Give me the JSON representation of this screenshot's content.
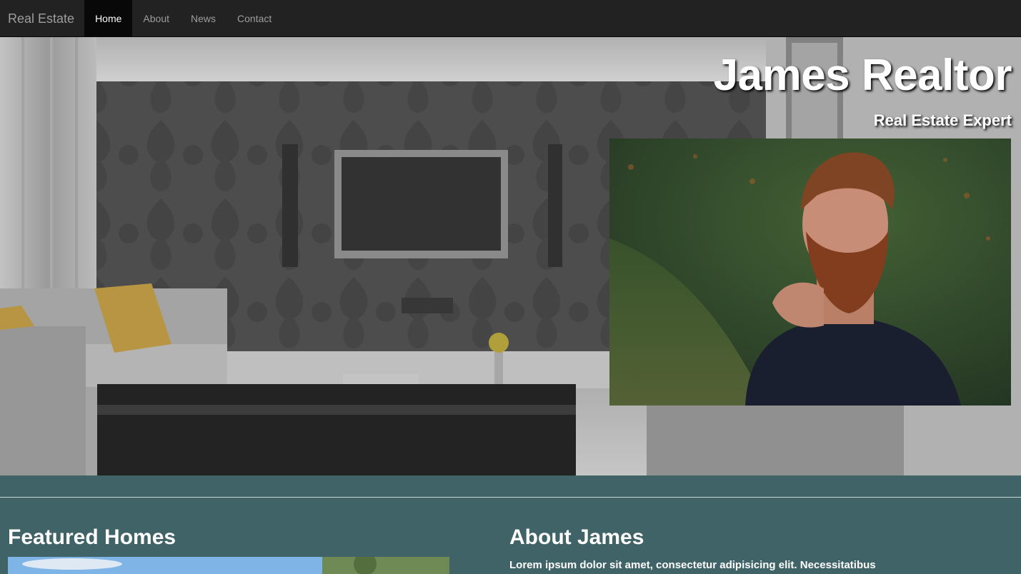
{
  "navbar": {
    "brand": "Real Estate",
    "items": [
      {
        "label": "Home",
        "active": true
      },
      {
        "label": "About",
        "active": false
      },
      {
        "label": "News",
        "active": false
      },
      {
        "label": "Contact",
        "active": false
      }
    ]
  },
  "hero": {
    "title": "James Realtor",
    "subtitle": "Real Estate Expert"
  },
  "featured": {
    "heading": "Featured Homes"
  },
  "about": {
    "heading": "About James",
    "text": "Lorem ipsum dolor sit amet, consectetur adipisicing elit. Necessitatibus"
  },
  "colors": {
    "navbar_bg": "#222222",
    "nav_active_bg": "#080808",
    "section_bg": "#406367"
  }
}
